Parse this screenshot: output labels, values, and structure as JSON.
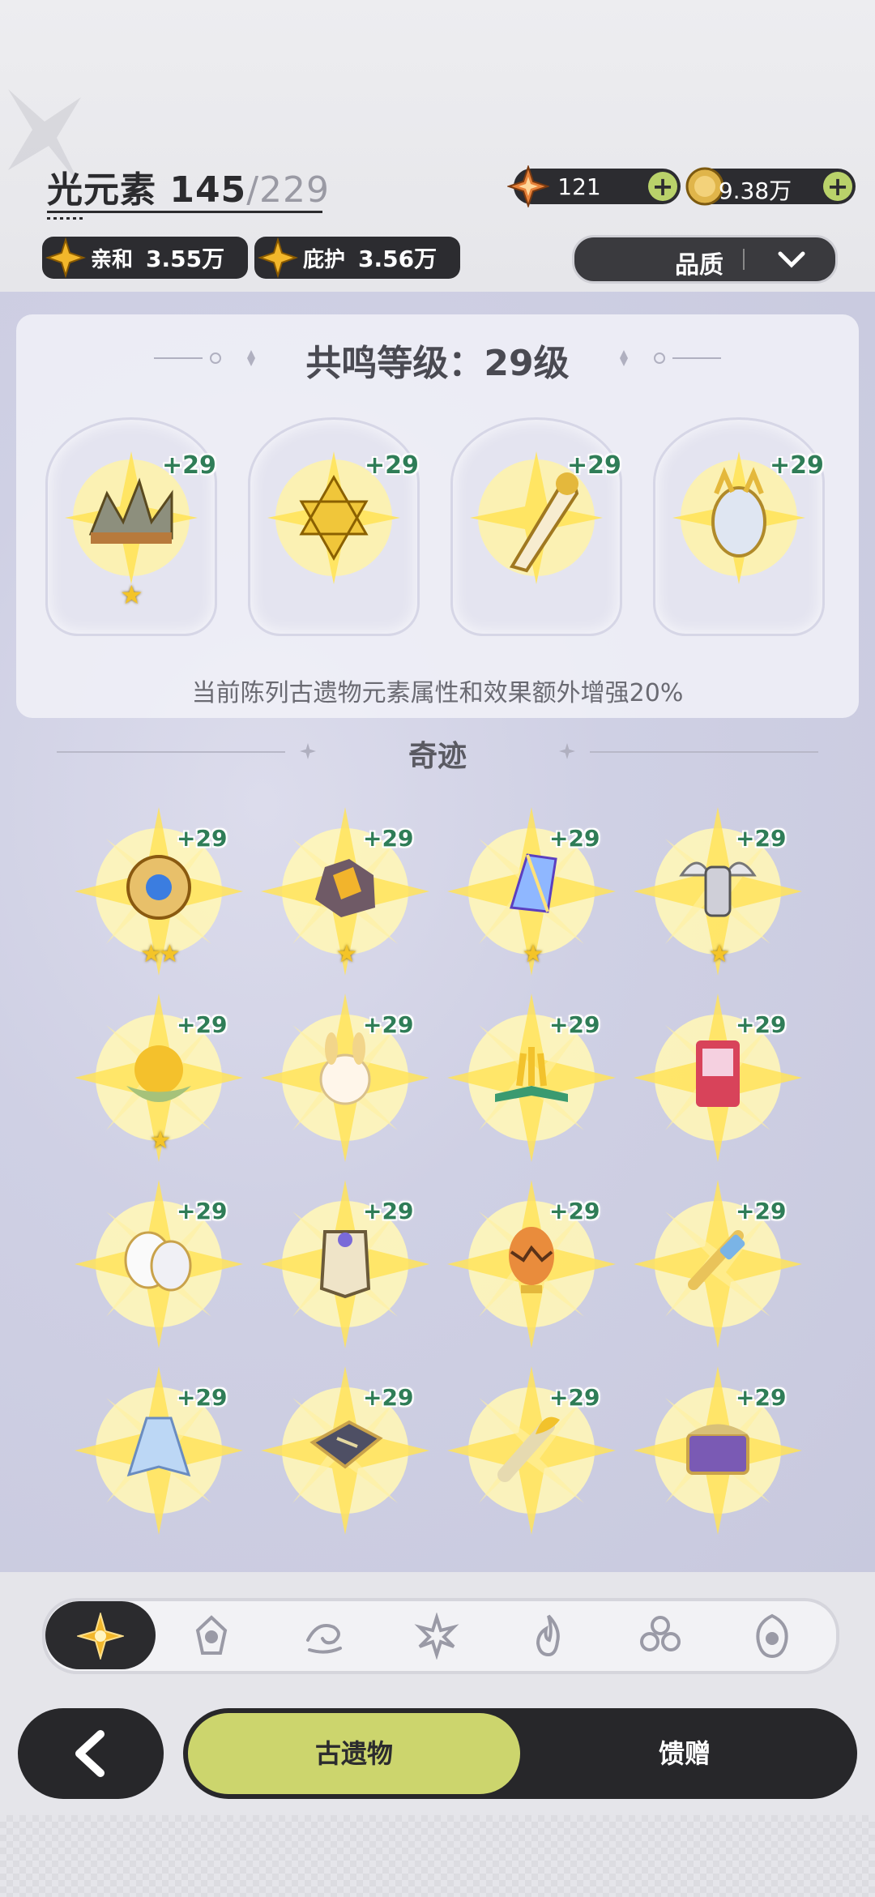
{
  "header": {
    "element_name": "光元素",
    "count_current": "145",
    "count_total": "/229",
    "affinity": {
      "label": "亲和",
      "value": "3.55万"
    },
    "protection": {
      "label": "庇护",
      "value": "3.56万"
    },
    "currency_star": "121",
    "currency_coin": "9.38万",
    "quality_label": "品质"
  },
  "resonance": {
    "title": "共鸣等级：29级",
    "slots": [
      {
        "name": "spiked-crown",
        "bonus": "+29",
        "stars": 1
      },
      {
        "name": "golden-star-prism",
        "bonus": "+29",
        "stars": 0
      },
      {
        "name": "golden-horn",
        "bonus": "+29",
        "stars": 0
      },
      {
        "name": "jeweled-egg",
        "bonus": "+29",
        "stars": 0
      }
    ],
    "description": "当前陈列古遗物元素属性和效果额外增强20%"
  },
  "section": {
    "title": "奇迹"
  },
  "relics": [
    {
      "name": "pocket-watch",
      "bonus": "+29",
      "stars": "★★"
    },
    {
      "name": "amber-rock",
      "bonus": "+29",
      "stars": "★"
    },
    {
      "name": "rainbow-crystal",
      "bonus": "+29",
      "stars": "★"
    },
    {
      "name": "winged-reliquary",
      "bonus": "+29",
      "stars": "★"
    },
    {
      "name": "golden-lotus",
      "bonus": "+29",
      "stars": "★"
    },
    {
      "name": "fluffy-bunny",
      "bonus": "+29",
      "stars": ""
    },
    {
      "name": "flower-book",
      "bonus": "+29",
      "stars": ""
    },
    {
      "name": "claw-machine",
      "bonus": "+29",
      "stars": ""
    },
    {
      "name": "theater-masks",
      "bonus": "+29",
      "stars": ""
    },
    {
      "name": "ornate-banner",
      "bonus": "+29",
      "stars": ""
    },
    {
      "name": "cracked-egg",
      "bonus": "+29",
      "stars": ""
    },
    {
      "name": "golden-key",
      "bonus": "+29",
      "stars": ""
    },
    {
      "name": "blue-robe",
      "bonus": "+29",
      "stars": ""
    },
    {
      "name": "stone-tablet",
      "bonus": "+29",
      "stars": ""
    },
    {
      "name": "golden-horn-branch",
      "bonus": "+29",
      "stars": ""
    },
    {
      "name": "treasure-chest",
      "bonus": "+29",
      "stars": ""
    }
  ],
  "element_tabs": [
    "light",
    "crystal",
    "wind",
    "lotus",
    "fire",
    "leaf",
    "void"
  ],
  "tabs": {
    "relics": "古遗物",
    "gifts": "馈赠"
  },
  "colors": {
    "accent": "#ccd56d",
    "dark": "#27272a",
    "gold": "#f4c428",
    "bonus_green": "#2f7d57"
  }
}
